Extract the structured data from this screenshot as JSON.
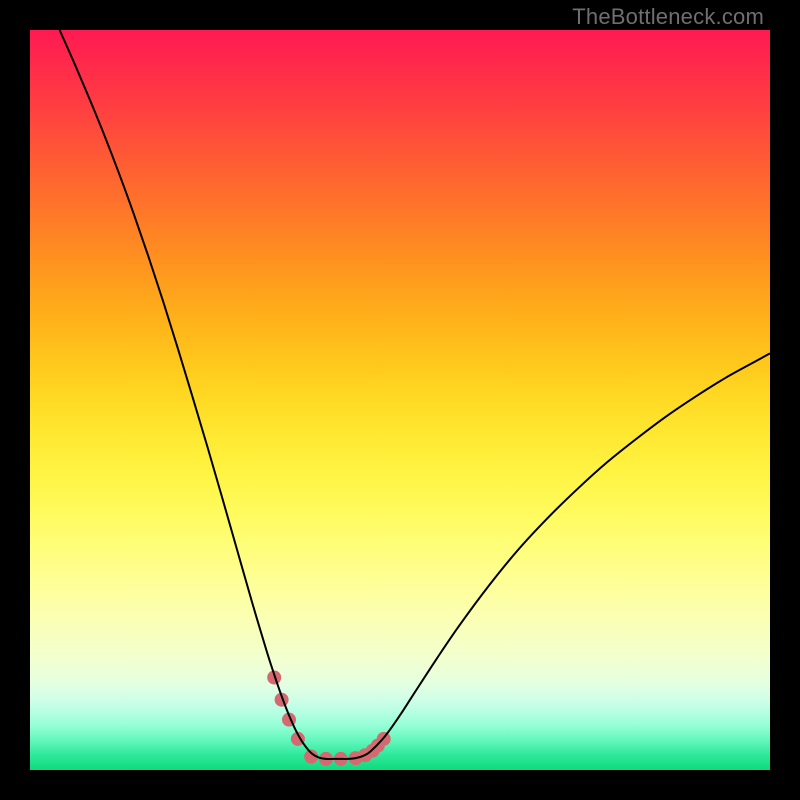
{
  "watermark": "TheBottleneck.com",
  "chart_data": {
    "type": "line",
    "title": "",
    "xlabel": "",
    "ylabel": "",
    "xlim": [
      0,
      100
    ],
    "ylim": [
      0,
      100
    ],
    "grid": false,
    "legend": false,
    "background": {
      "bands": [
        {
          "y": 100,
          "color": "#ff1a52"
        },
        {
          "y": 95,
          "color": "#ff2b4a"
        },
        {
          "y": 90,
          "color": "#ff3d42"
        },
        {
          "y": 85,
          "color": "#ff5139"
        },
        {
          "y": 80,
          "color": "#ff6530"
        },
        {
          "y": 75,
          "color": "#ff7928"
        },
        {
          "y": 70,
          "color": "#ff8d21"
        },
        {
          "y": 65,
          "color": "#ffa11c"
        },
        {
          "y": 60,
          "color": "#ffb51a"
        },
        {
          "y": 55,
          "color": "#ffc81c"
        },
        {
          "y": 50,
          "color": "#ffda24"
        },
        {
          "y": 45,
          "color": "#ffe932"
        },
        {
          "y": 40,
          "color": "#fff444"
        },
        {
          "y": 35,
          "color": "#fffb5d"
        },
        {
          "y": 30,
          "color": "#fffe7a"
        },
        {
          "y": 25,
          "color": "#feff99"
        },
        {
          "y": 20,
          "color": "#faffb6"
        },
        {
          "y": 15,
          "color": "#f2ffcf"
        },
        {
          "y": 12,
          "color": "#e6ffdf"
        },
        {
          "y": 10,
          "color": "#d4ffe7"
        },
        {
          "y": 8,
          "color": "#b8ffe4"
        },
        {
          "y": 6,
          "color": "#94ffd6"
        },
        {
          "y": 4,
          "color": "#62f7bc"
        },
        {
          "y": 2,
          "color": "#2ee99a"
        },
        {
          "y": 0,
          "color": "#0fd97d"
        }
      ]
    },
    "series": [
      {
        "name": "bottleneck-curve",
        "color": "#000000",
        "width": 2,
        "x": [
          4,
          6,
          8,
          10,
          12,
          14,
          16,
          18,
          20,
          22,
          24,
          26,
          28,
          30,
          32,
          33,
          34,
          35,
          36,
          37,
          38,
          39,
          40,
          41,
          42,
          43,
          44,
          45,
          46,
          48,
          50,
          52,
          55,
          58,
          62,
          66,
          70,
          74,
          78,
          82,
          86,
          90,
          94,
          98,
          100
        ],
        "y": [
          100,
          95.5,
          90.8,
          85.9,
          80.7,
          75.2,
          69.4,
          63.3,
          56.9,
          50.3,
          43.6,
          36.7,
          29.7,
          22.7,
          16.0,
          12.9,
          10.0,
          7.4,
          5.2,
          3.5,
          2.3,
          1.7,
          1.5,
          1.5,
          1.5,
          1.5,
          1.6,
          1.9,
          2.5,
          4.6,
          7.4,
          10.5,
          15.1,
          19.5,
          24.9,
          29.8,
          34.1,
          38.0,
          41.6,
          44.8,
          47.8,
          50.5,
          53.0,
          55.2,
          56.3
        ]
      }
    ],
    "markers": {
      "name": "highlighted-points",
      "color": "#d46a6f",
      "radius": 7,
      "x": [
        33.0,
        34.0,
        35.0,
        36.2,
        38.0,
        40.0,
        42.0,
        44.0,
        45.3,
        46.3,
        47.0,
        47.8
      ],
      "y": [
        12.5,
        9.5,
        6.8,
        4.2,
        1.8,
        1.5,
        1.5,
        1.6,
        2.0,
        2.6,
        3.3,
        4.2
      ]
    }
  }
}
